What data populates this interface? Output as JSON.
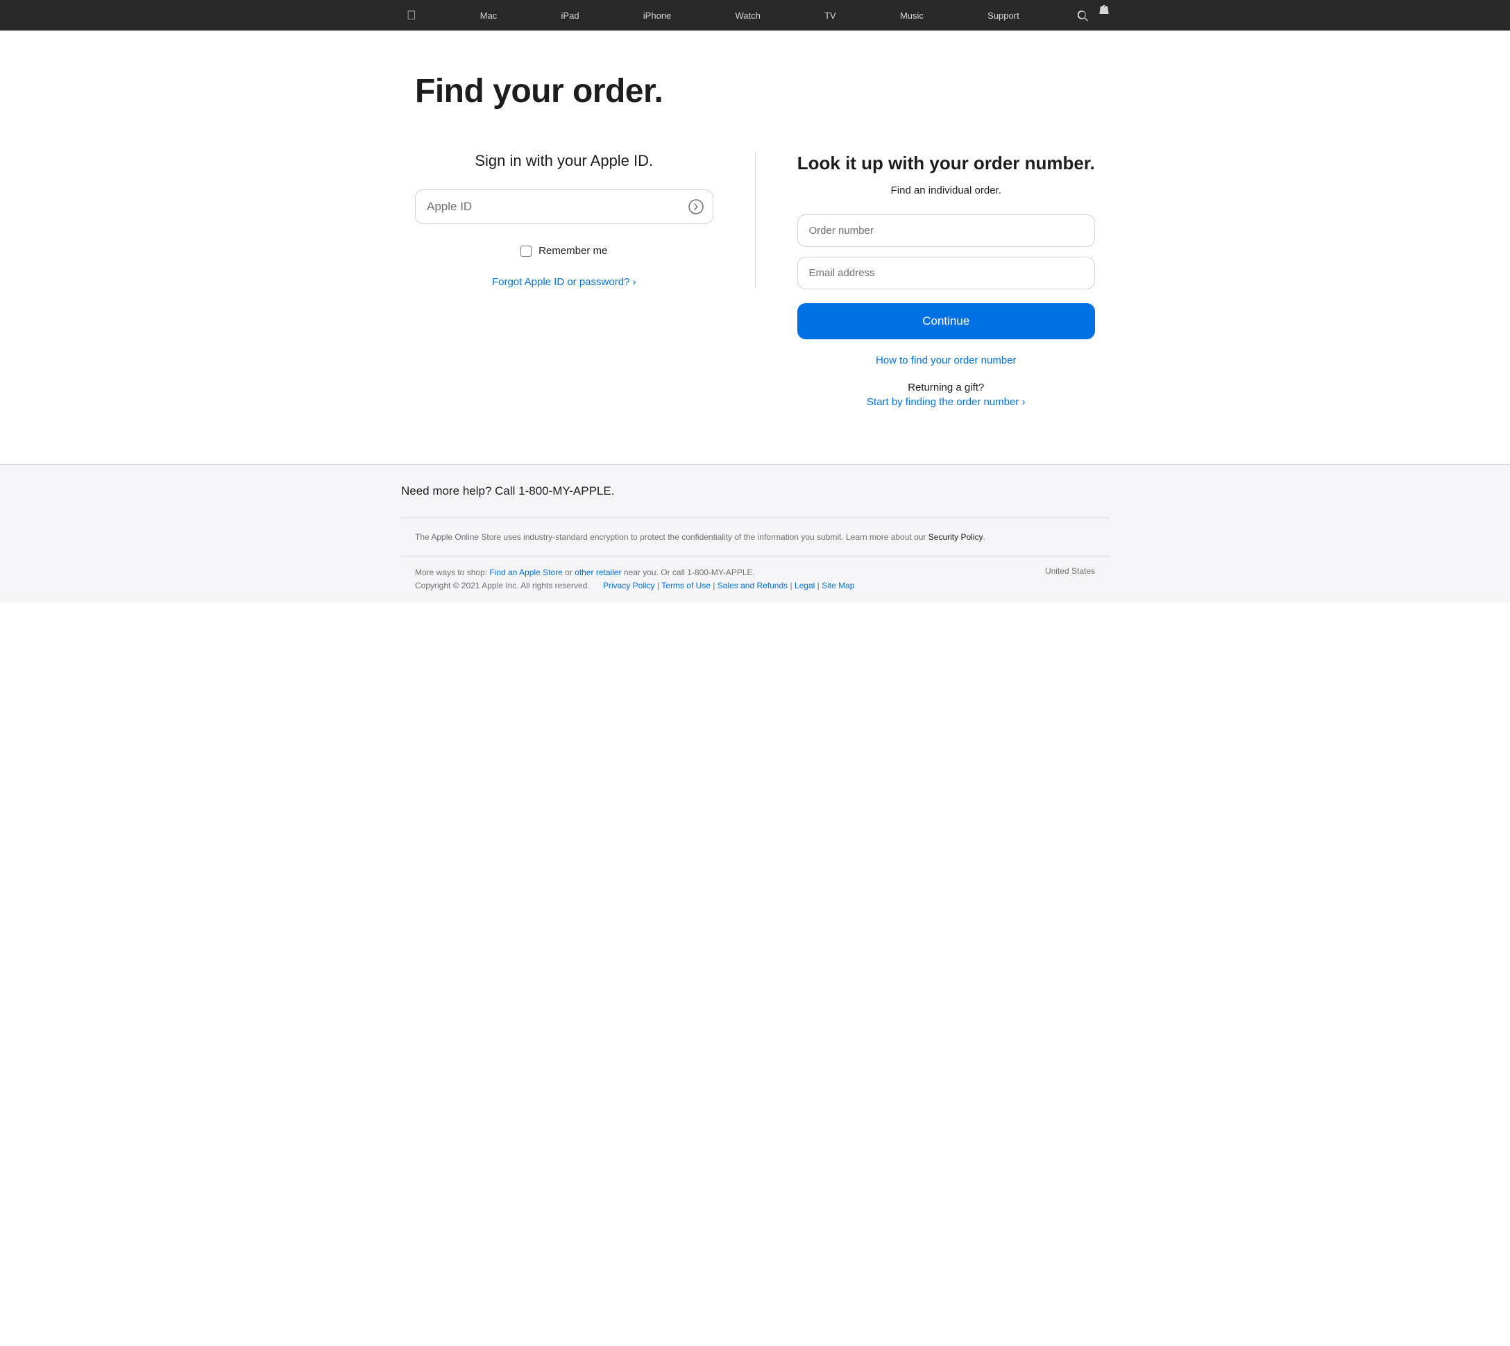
{
  "nav": {
    "apple_logo": "&#xf8ff;",
    "items": [
      {
        "id": "mac",
        "label": "Mac"
      },
      {
        "id": "ipad",
        "label": "iPad"
      },
      {
        "id": "iphone",
        "label": "iPhone"
      },
      {
        "id": "watch",
        "label": "Watch"
      },
      {
        "id": "tv",
        "label": "TV"
      },
      {
        "id": "music",
        "label": "Music"
      },
      {
        "id": "support",
        "label": "Support"
      }
    ],
    "search_icon": "🔍",
    "bag_icon": "🛍"
  },
  "page": {
    "title": "Find your order.",
    "left_panel": {
      "title": "Sign in with your Apple ID.",
      "apple_id_placeholder": "Apple ID",
      "arrow_icon": "→",
      "remember_me_label": "Remember me",
      "forgot_link": "Forgot Apple ID or password? ›"
    },
    "right_panel": {
      "title": "Look it up with your order number.",
      "subtitle": "Find an individual order.",
      "order_number_placeholder": "Order number",
      "email_placeholder": "Email address",
      "continue_button": "Continue",
      "how_to_find_link": "How to find your order number",
      "returning_gift_text": "Returning a gift?",
      "start_finding_link": "Start by finding the order number ›"
    }
  },
  "help": {
    "text": "Need more help? Call 1-800-MY-APPLE."
  },
  "footer": {
    "security_text": "The Apple Online Store uses industry-standard encryption to protect the confidentiality of the information you submit. Learn more about our",
    "security_link_label": "Security Policy",
    "more_ways_text": "More ways to shop:",
    "find_store_link": "Find an Apple Store",
    "or_text": "or",
    "other_retailer_link": "other retailer",
    "near_you_text": "near you. Or call 1-800-MY-APPLE.",
    "copyright": "Copyright © 2021 Apple Inc. All rights reserved.",
    "links": [
      {
        "id": "privacy",
        "label": "Privacy Policy"
      },
      {
        "id": "terms",
        "label": "Terms of Use"
      },
      {
        "id": "sales",
        "label": "Sales and Refunds"
      },
      {
        "id": "legal",
        "label": "Legal"
      },
      {
        "id": "sitemap",
        "label": "Site Map"
      }
    ],
    "country": "United States"
  }
}
